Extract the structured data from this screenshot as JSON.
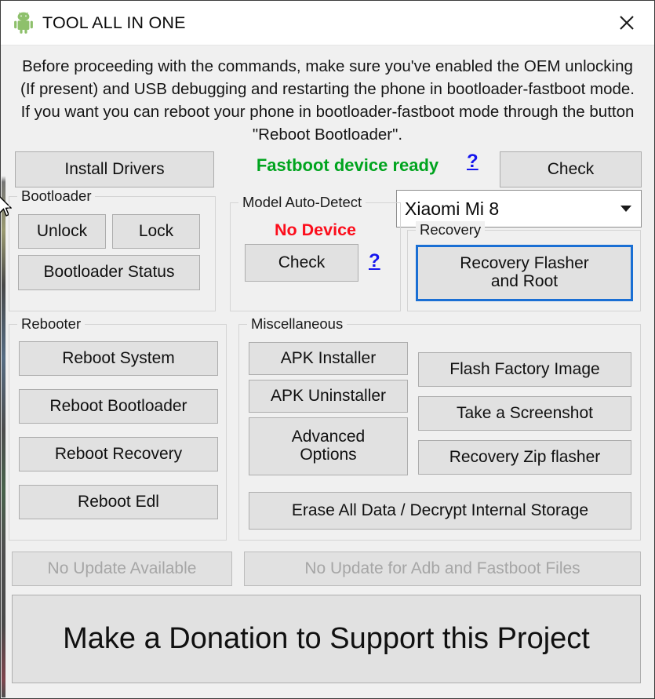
{
  "window": {
    "title": "TOOL ALL IN ONE",
    "app_icon": "android-robot-icon",
    "close_label": "✕"
  },
  "notice": {
    "text": "Before proceeding with the commands, make sure you've enabled the OEM unlocking (If present) and USB debugging and restarting the phone in bootloader-fastboot mode. If you want you can reboot your phone in bootloader-fastboot mode through the button \"Reboot Bootloader\"."
  },
  "toolbar": {
    "install_drivers_label": "Install Drivers",
    "fastboot_status": "Fastboot device ready",
    "fastboot_status_color": "#00a41e",
    "fastboot_help_label": "?",
    "check_label": "Check"
  },
  "device_select": {
    "value": "Xiaomi Mi 8",
    "arrow_icon": "chevron-down-icon"
  },
  "bootloader": {
    "legend": "Bootloader",
    "unlock_label": "Unlock",
    "lock_label": "Lock",
    "status_label": "Bootloader Status"
  },
  "model_auto_detect": {
    "legend": "Model Auto-Detect",
    "status": "No Device",
    "status_color": "#fc0d1b",
    "check_label": "Check",
    "help_label": "?"
  },
  "recovery": {
    "legend": "Recovery",
    "flasher_label": "Recovery Flasher and Root",
    "flasher_line1": "Recovery Flasher",
    "flasher_line2": "and Root",
    "focus_color": "#1a6fd4"
  },
  "rebooter": {
    "legend": "Rebooter",
    "buttons": [
      {
        "label": "Reboot System"
      },
      {
        "label": "Reboot Bootloader"
      },
      {
        "label": "Reboot Recovery"
      },
      {
        "label": "Reboot Edl"
      }
    ]
  },
  "miscellaneous": {
    "legend": "Miscellaneous",
    "left_buttons": [
      {
        "label": "APK Installer"
      },
      {
        "label": "APK Uninstaller"
      },
      {
        "label": "Advanced Options",
        "line1": "Advanced",
        "line2": "Options"
      }
    ],
    "right_buttons": [
      {
        "label": "Flash Factory Image"
      },
      {
        "label": "Take a Screenshot"
      },
      {
        "label": "Recovery Zip flasher"
      }
    ],
    "wide_button_label": "Erase All Data / Decrypt Internal Storage"
  },
  "footer": {
    "update_app_label": "No Update Available",
    "update_app_disabled": true,
    "update_files_label": "No Update for Adb and Fastboot Files",
    "update_files_disabled": true,
    "donation_label": "Make a Donation to Support this Project"
  }
}
